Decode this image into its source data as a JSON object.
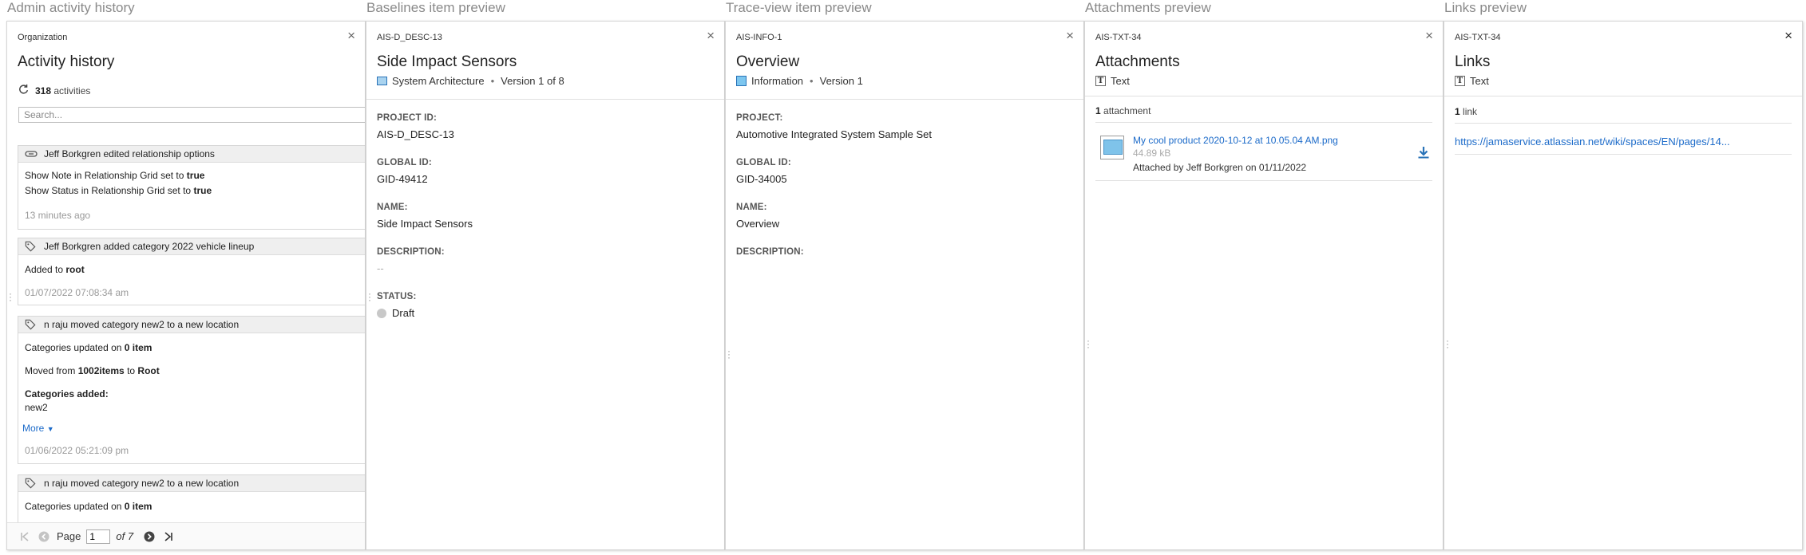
{
  "captions": {
    "admin": "Admin activity history",
    "baselines": "Baselines item preview",
    "trace": "Trace-view item preview",
    "attachments": "Attachments preview",
    "links": "Links preview"
  },
  "activity": {
    "top": "Organization",
    "title": "Activity history",
    "count": "318",
    "count_label": "activities",
    "search_placeholder": "Search...",
    "entries": [
      {
        "icon": "link-icon",
        "header": "Jeff Borkgren edited relationship options",
        "lines": [
          {
            "pre": "Show Note in Relationship Grid set to ",
            "bold": "true"
          },
          {
            "pre": "Show Status in Relationship Grid set to ",
            "bold": "true"
          }
        ],
        "time": "13 minutes ago"
      },
      {
        "icon": "tag-icon",
        "header": "Jeff Borkgren added category 2022 vehicle lineup",
        "lines": [
          {
            "pre": "Added to ",
            "bold": "root"
          }
        ],
        "time": "01/07/2022 07:08:34 am"
      },
      {
        "icon": "tag-icon",
        "header": "n raju moved category new2 to a new location",
        "lines": [
          {
            "pre": "Categories updated on ",
            "bold": "0 item"
          },
          {
            "pre": "Moved from ",
            "bold": "1002items",
            "mid": " to ",
            "bold2": "Root"
          },
          {
            "bold": "Categories added:"
          },
          {
            "pre": "new2"
          }
        ],
        "more": "More",
        "time": "01/06/2022 05:21:09 pm"
      },
      {
        "icon": "tag-icon",
        "header": "n raju moved category new2 to a new location",
        "lines": [
          {
            "pre": "Categories updated on ",
            "bold": "0 item"
          }
        ]
      }
    ],
    "pager": {
      "page_label": "Page",
      "page": "1",
      "of_label": "of 7"
    }
  },
  "baselines": {
    "top": "AIS-D_DESC-13",
    "title": "Side Impact Sensors",
    "type": "System Architecture",
    "version": "Version 1 of 8",
    "fields": {
      "project_id_label": "PROJECT ID:",
      "project_id": "AIS-D_DESC-13",
      "global_id_label": "GLOBAL ID:",
      "global_id": "GID-49412",
      "name_label": "NAME:",
      "name": "Side Impact Sensors",
      "description_label": "DESCRIPTION:",
      "description": "--",
      "status_label": "STATUS:",
      "status": "Draft"
    }
  },
  "trace": {
    "top": "AIS-INFO-1",
    "title": "Overview",
    "type": "Information",
    "version": "Version 1",
    "fields": {
      "project_label": "PROJECT:",
      "project": "Automotive Integrated System Sample Set",
      "global_id_label": "GLOBAL ID:",
      "global_id": "GID-34005",
      "name_label": "NAME:",
      "name": "Overview",
      "description_label": "DESCRIPTION:"
    }
  },
  "attachments": {
    "top": "AIS-TXT-34",
    "title": "Attachments",
    "type": "Text",
    "count": "1",
    "count_label": "attachment",
    "item": {
      "name": "My cool product 2020-10-12 at 10.05.04 AM.png",
      "size": "44.89 kB",
      "by": "Attached by Jeff Borkgren on 01/11/2022"
    }
  },
  "links": {
    "top": "AIS-TXT-34",
    "title": "Links",
    "type": "Text",
    "count": "1",
    "count_label": "link",
    "url": "https://jamaservice.atlassian.net/wiki/spaces/EN/pages/14..."
  },
  "colors": {
    "link": "#1b6ac9",
    "accent": "#2a73b8",
    "status_draft": "#c8c8c8"
  }
}
